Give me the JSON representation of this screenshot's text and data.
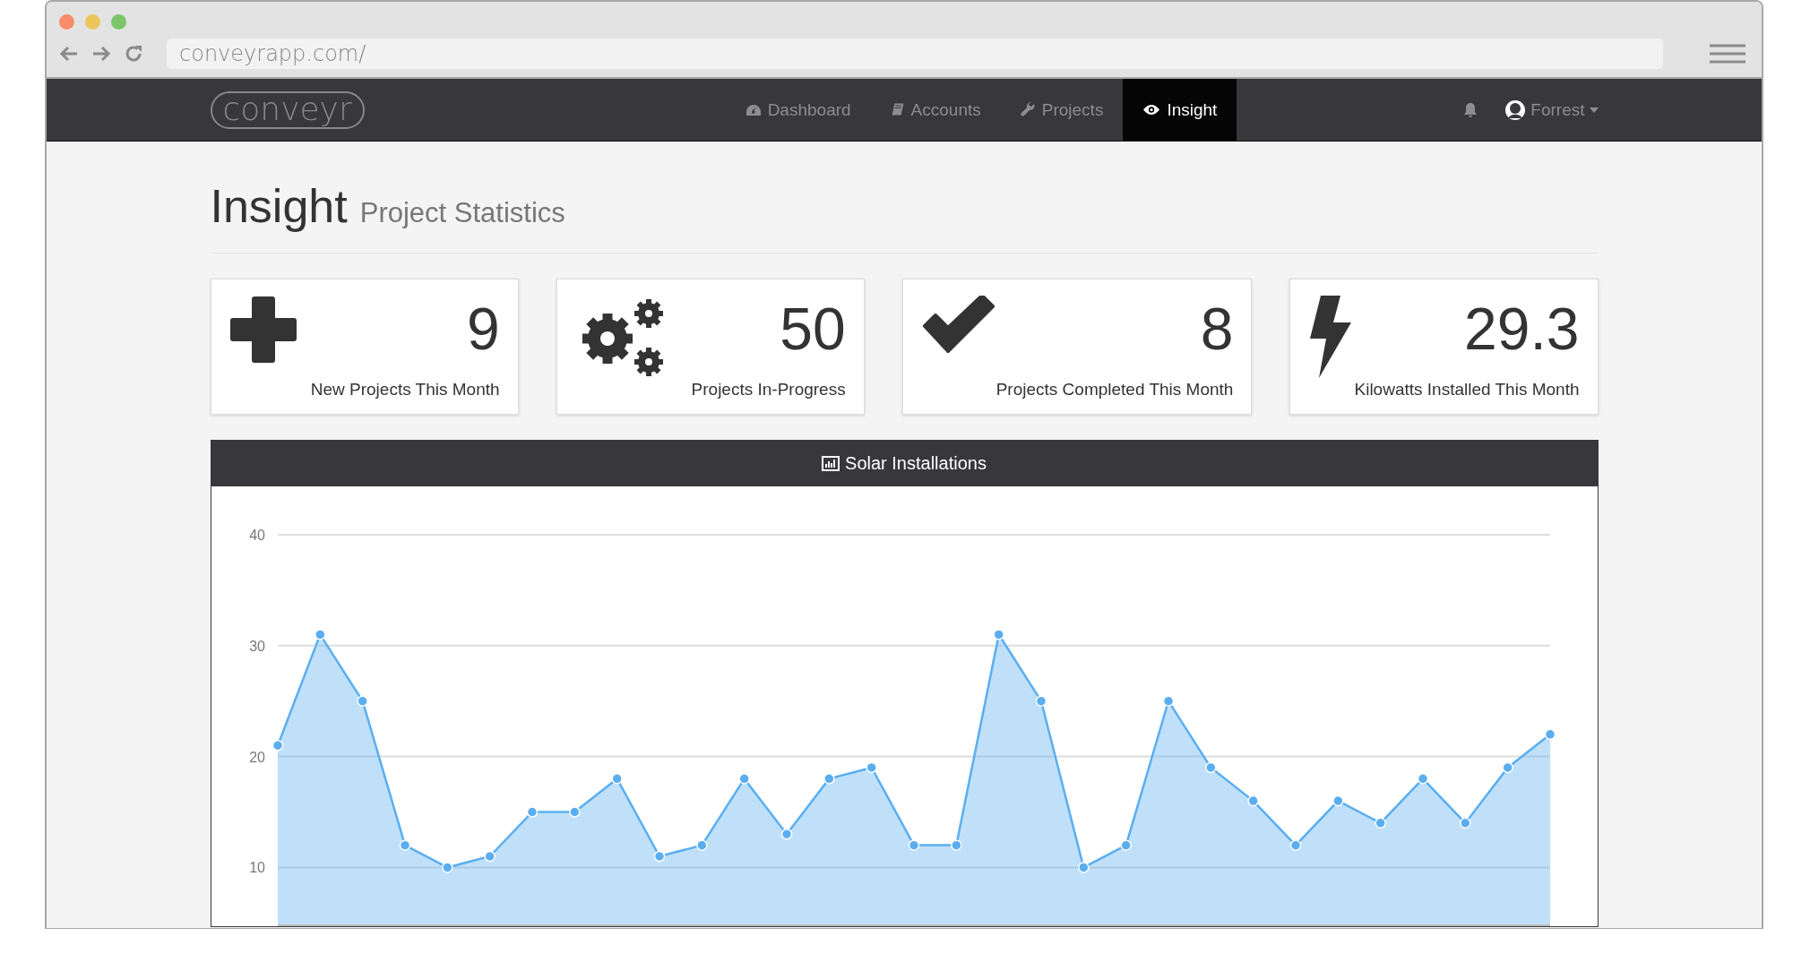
{
  "browser": {
    "url": "conveyrapp.com/"
  },
  "navbar": {
    "logo": "conveyr",
    "items": [
      {
        "label": "Dashboard",
        "selected": false
      },
      {
        "label": "Accounts",
        "selected": false
      },
      {
        "label": "Projects",
        "selected": false
      },
      {
        "label": "Insight",
        "selected": true
      }
    ],
    "user": "Forrest"
  },
  "page_header": {
    "title": "Insight",
    "subtitle": "Project Statistics"
  },
  "stats": [
    {
      "value": "9",
      "label": "New Projects This Month"
    },
    {
      "value": "50",
      "label": "Projects In-Progress"
    },
    {
      "value": "8",
      "label": "Projects Completed This Month"
    },
    {
      "value": "29.3",
      "label": "Kilowatts Installed This Month"
    }
  ],
  "chart_panel": {
    "title": "Solar Installations",
    "chart_data": {
      "type": "area",
      "grid": true,
      "ylim": [
        4.7,
        40
      ],
      "yticks": [
        10,
        20,
        30,
        40
      ],
      "series": [
        {
          "color": "#5aaef0",
          "values": [
            21,
            31,
            25,
            12,
            10,
            11,
            15,
            15,
            18,
            11,
            12,
            18,
            13,
            18,
            19,
            12,
            12,
            31,
            25,
            10,
            12,
            25,
            19,
            16,
            12,
            16,
            14,
            18,
            14,
            19,
            22
          ]
        }
      ]
    }
  }
}
